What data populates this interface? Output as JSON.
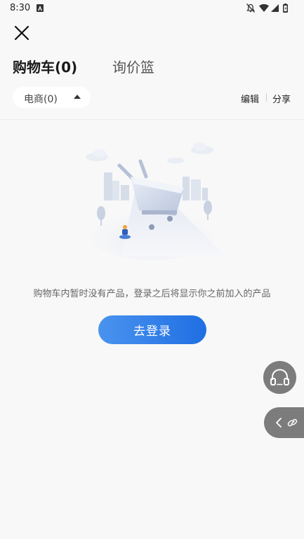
{
  "status_bar": {
    "time": "8:30",
    "icons": [
      "a-icon",
      "bell-off-icon",
      "wifi-icon",
      "signal-icon",
      "battery-icon"
    ]
  },
  "header": {
    "close_icon": "close-icon"
  },
  "tabs": [
    {
      "label": "购物车(0)",
      "active": true
    },
    {
      "label": "询价篮",
      "active": false
    }
  ],
  "filter": {
    "selected": "电商(0)",
    "edit_label": "编辑",
    "share_label": "分享"
  },
  "empty_state": {
    "illustration": "empty-shopping-cart-illustration",
    "message": "购物车内暂时没有产品，登录之后将显示你之前加入的产品",
    "login_label": "去登录"
  },
  "floating": {
    "support_icon": "headphones-icon",
    "share_icons": [
      "chevron-left-icon",
      "link-icon"
    ]
  },
  "colors": {
    "background": "#f8f8f8",
    "accent": "#1f6fe3",
    "accent_light": "#4a93ef",
    "floating": "#7c7c7c"
  }
}
